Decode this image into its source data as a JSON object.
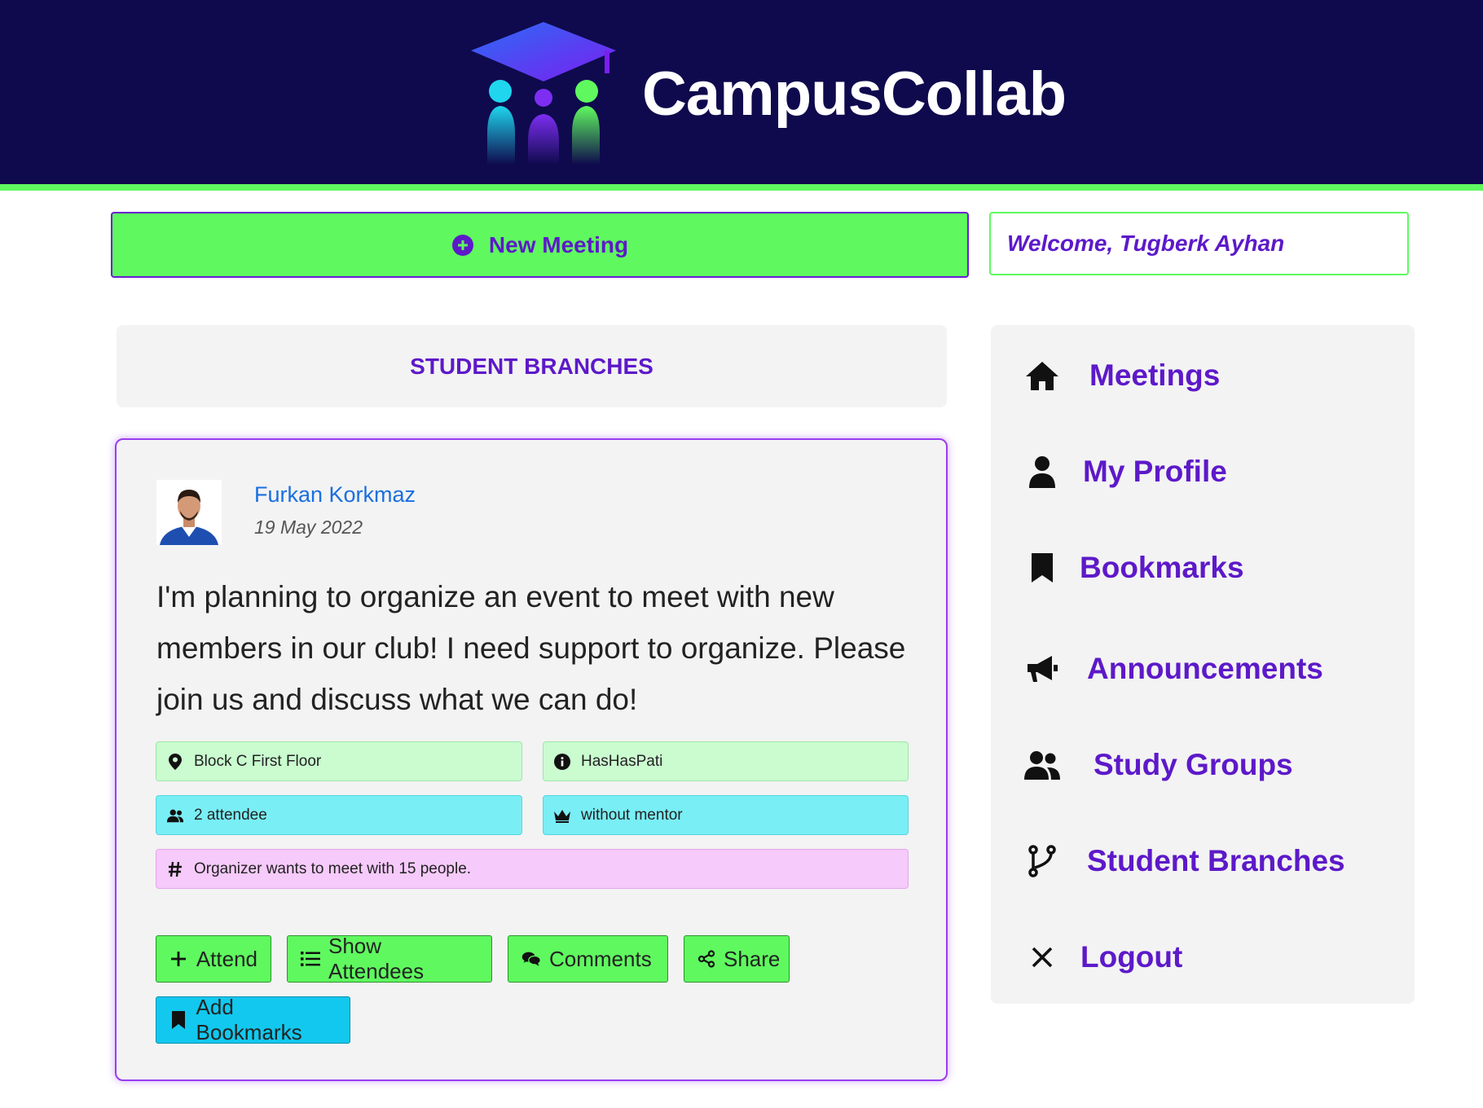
{
  "header": {
    "brand": "CampusCollab"
  },
  "actions": {
    "new_meeting_label": "New Meeting",
    "welcome_text": "Welcome, Tugberk Ayhan"
  },
  "section": {
    "title": "STUDENT BRANCHES"
  },
  "post": {
    "author": "Furkan Korkmaz",
    "date": "19 May 2022",
    "body": "I'm planning to organize an event to meet with new members in our club! I need support to organize. Please join us and discuss what we can do!",
    "tags": {
      "location": "Block C First Floor",
      "info": "HasHasPati",
      "attendees": "2 attendee",
      "mentor": "without mentor",
      "note": "Organizer wants to meet with 15 people."
    },
    "buttons": {
      "attend": "Attend",
      "show_attendees": "Show Attendees",
      "comments": "Comments",
      "share": "Share",
      "add_bookmarks": "Add Bookmarks"
    }
  },
  "sidebar": {
    "items": [
      {
        "label": "Meetings",
        "icon": "home-icon"
      },
      {
        "label": "My Profile",
        "icon": "user-icon"
      },
      {
        "label": "Bookmarks",
        "icon": "bookmark-icon"
      },
      {
        "label": "Announcements",
        "icon": "megaphone-icon"
      },
      {
        "label": "Study Groups",
        "icon": "users-icon"
      },
      {
        "label": "Student Branches",
        "icon": "branch-icon"
      },
      {
        "label": "Logout",
        "icon": "close-icon"
      }
    ]
  },
  "colors": {
    "header_bg": "#0f0a4d",
    "accent_green": "#5ff95f",
    "accent_purple": "#5d19c9",
    "link_blue": "#1a6fe0",
    "button_blue": "#12c8ee"
  }
}
